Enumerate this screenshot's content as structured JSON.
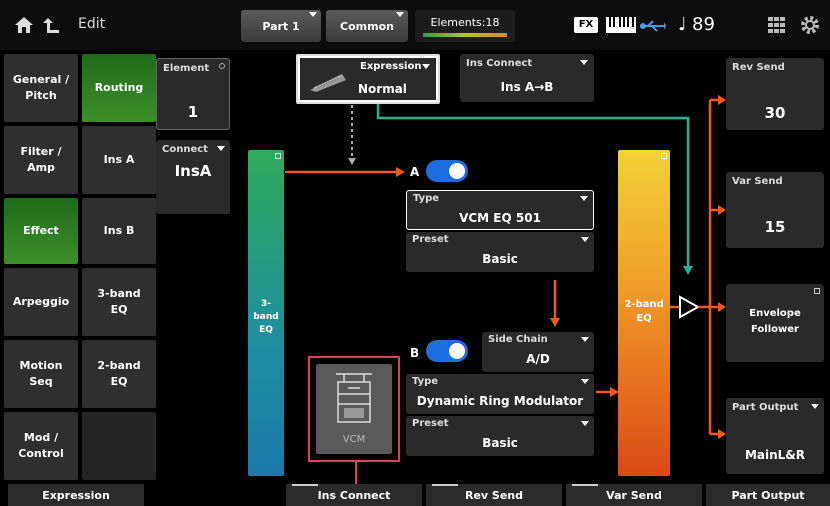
{
  "header": {
    "title": "Edit",
    "part_button": "Part 1",
    "common_button": "Common",
    "elements_label": "Elements:18",
    "fx_label": "FX",
    "tempo": "89"
  },
  "left_tabs": [
    "General / Pitch",
    "Filter / Amp",
    "Effect",
    "Arpeggio",
    "Motion Seq",
    "Mod / Control"
  ],
  "sub_tabs": [
    "Routing",
    "Ins A",
    "Ins B",
    "3-band EQ",
    "2-band EQ"
  ],
  "element": {
    "label": "Element",
    "value": "1"
  },
  "connect": {
    "label": "Connect",
    "value": "InsA"
  },
  "expression": {
    "label": "Expression",
    "value": "Normal"
  },
  "ins_connect": {
    "label": "Ins Connect",
    "value": "Ins A→B"
  },
  "eq3": {
    "label": "3-band EQ"
  },
  "eq2": {
    "label": "2-band EQ"
  },
  "ins_a": {
    "letter": "A",
    "type_label": "Type",
    "type_value": "VCM EQ 501",
    "preset_label": "Preset",
    "preset_value": "Basic"
  },
  "ins_b": {
    "letter": "B",
    "side_chain_label": "Side Chain",
    "side_chain_value": "A/D",
    "type_label": "Type",
    "type_value": "Dynamic Ring Modulator",
    "preset_label": "Preset",
    "preset_value": "Basic"
  },
  "vcm_label": "VCM",
  "rev_send": {
    "label": "Rev Send",
    "value": "30"
  },
  "var_send": {
    "label": "Var Send",
    "value": "15"
  },
  "envelope_follower": "Envelope Follower",
  "part_output": {
    "label": "Part Output",
    "value": "MainL&R"
  },
  "bottom_tabs": [
    "Expression",
    "Ins Connect",
    "Rev Send",
    "Var Send",
    "Part Output"
  ],
  "colors": {
    "accent_orange": "#f05a1e",
    "teal_line": "#1fb39a",
    "toggle_blue": "#1d6de0",
    "active_tab_green": "#2f7d25"
  }
}
